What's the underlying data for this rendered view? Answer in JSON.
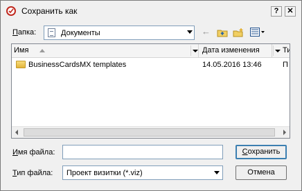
{
  "window": {
    "title": "Сохранить как",
    "help_label": "?",
    "close_label": "✕"
  },
  "location": {
    "label_u": "П",
    "label_rest": "апка:",
    "value": "Документы"
  },
  "toolbar": {
    "back_icon": "←"
  },
  "list": {
    "columns": [
      "Имя",
      "Дата изменения",
      "Ти"
    ],
    "rows": [
      {
        "name": "BusinessCardsMX templates",
        "date": "14.05.2016 13:46",
        "type": "П"
      }
    ]
  },
  "filename": {
    "label_u": "И",
    "label_rest": "мя файла:",
    "value": ""
  },
  "filetype": {
    "label_u": "Т",
    "label_rest": "ип файла:",
    "value": "Проект визитки (*.viz)"
  },
  "buttons": {
    "save_u": "С",
    "save_rest": "охранить",
    "cancel": "Отмена"
  },
  "colors": {
    "accent": "#3c7fb1",
    "title_icon": "#c0281e",
    "folder": "#e3b53a"
  }
}
